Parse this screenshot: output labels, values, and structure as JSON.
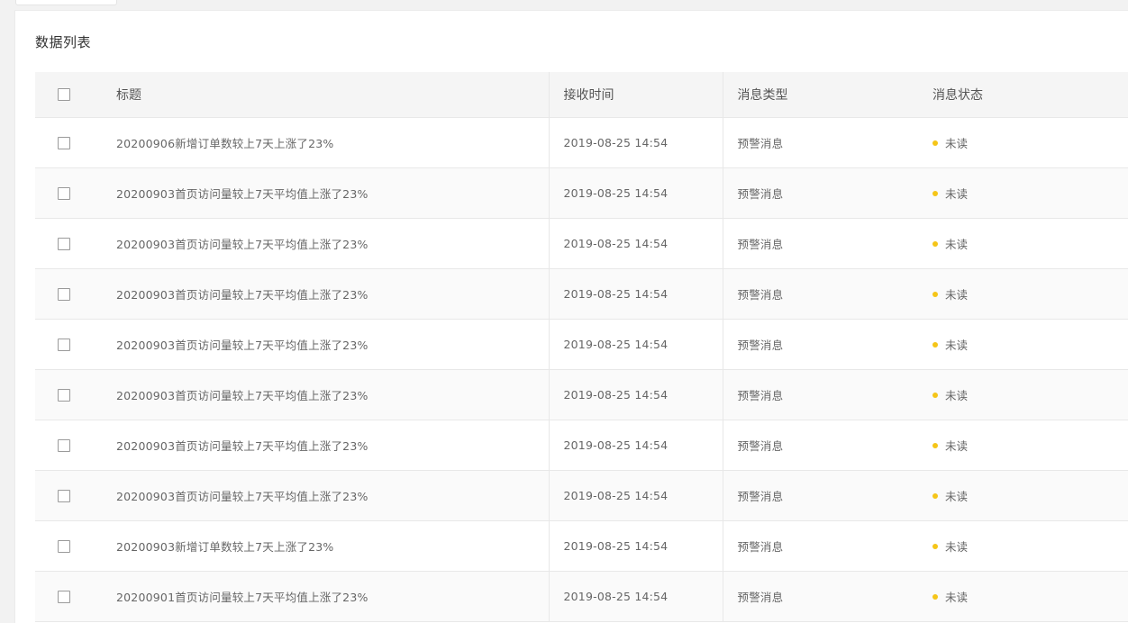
{
  "panel": {
    "title": "数据列表"
  },
  "table": {
    "columns": {
      "title": "标题",
      "received_time": "接收时间",
      "message_type": "消息类型",
      "message_status": "消息状态"
    },
    "rows": [
      {
        "title": "20200906新增订单数较上7天上涨了23%",
        "received_time": "2019-08-25 14:54",
        "message_type": "预警消息",
        "status": "未读"
      },
      {
        "title": "20200903首页访问量较上7天平均值上涨了23%",
        "received_time": "2019-08-25 14:54",
        "message_type": "预警消息",
        "status": "未读"
      },
      {
        "title": "20200903首页访问量较上7天平均值上涨了23%",
        "received_time": "2019-08-25 14:54",
        "message_type": "预警消息",
        "status": "未读"
      },
      {
        "title": "20200903首页访问量较上7天平均值上涨了23%",
        "received_time": "2019-08-25 14:54",
        "message_type": "预警消息",
        "status": "未读"
      },
      {
        "title": "20200903首页访问量较上7天平均值上涨了23%",
        "received_time": "2019-08-25 14:54",
        "message_type": "预警消息",
        "status": "未读"
      },
      {
        "title": "20200903首页访问量较上7天平均值上涨了23%",
        "received_time": "2019-08-25 14:54",
        "message_type": "预警消息",
        "status": "未读"
      },
      {
        "title": "20200903首页访问量较上7天平均值上涨了23%",
        "received_time": "2019-08-25 14:54",
        "message_type": "预警消息",
        "status": "未读"
      },
      {
        "title": "20200903首页访问量较上7天平均值上涨了23%",
        "received_time": "2019-08-25 14:54",
        "message_type": "预警消息",
        "status": "未读"
      },
      {
        "title": "20200903新增订单数较上7天上涨了23%",
        "received_time": "2019-08-25 14:54",
        "message_type": "预警消息",
        "status": "未读"
      },
      {
        "title": "20200901首页访问量较上7天平均值上涨了23%",
        "received_time": "2019-08-25 14:54",
        "message_type": "预警消息",
        "status": "未读"
      }
    ]
  },
  "colors": {
    "status_unread": "#f5c518",
    "header_bg": "#f5f5f5",
    "border": "#e8e8e8"
  }
}
